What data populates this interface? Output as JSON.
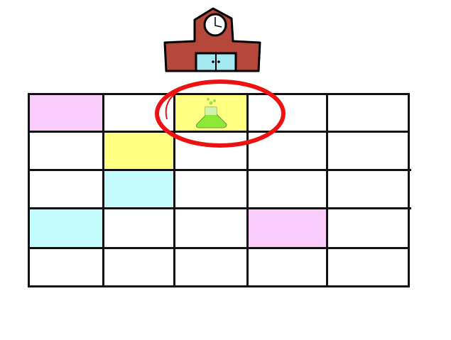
{
  "board": {
    "rows": 5,
    "cols": 5,
    "colors": {
      "pink": "#f9ccfb",
      "yellow": "#ffff80",
      "cyan": "#c4fbfc",
      "white": "#ffffff",
      "highlight": "#ee1111"
    },
    "cells": [
      [
        "pink",
        "white",
        "yellow",
        "white",
        "white"
      ],
      [
        "white",
        "yellow",
        "white",
        "white",
        "white"
      ],
      [
        "white",
        "cyan",
        "white",
        "white",
        "white"
      ],
      [
        "cyan",
        "white",
        "white",
        "pink",
        "white"
      ],
      [
        "white",
        "white",
        "white",
        "white",
        "white"
      ]
    ],
    "items": [
      {
        "row": 0,
        "col": 2,
        "icon": "flask-icon"
      }
    ],
    "highlighted": {
      "row": 0,
      "col": 2
    },
    "start_icon": "school-icon"
  }
}
